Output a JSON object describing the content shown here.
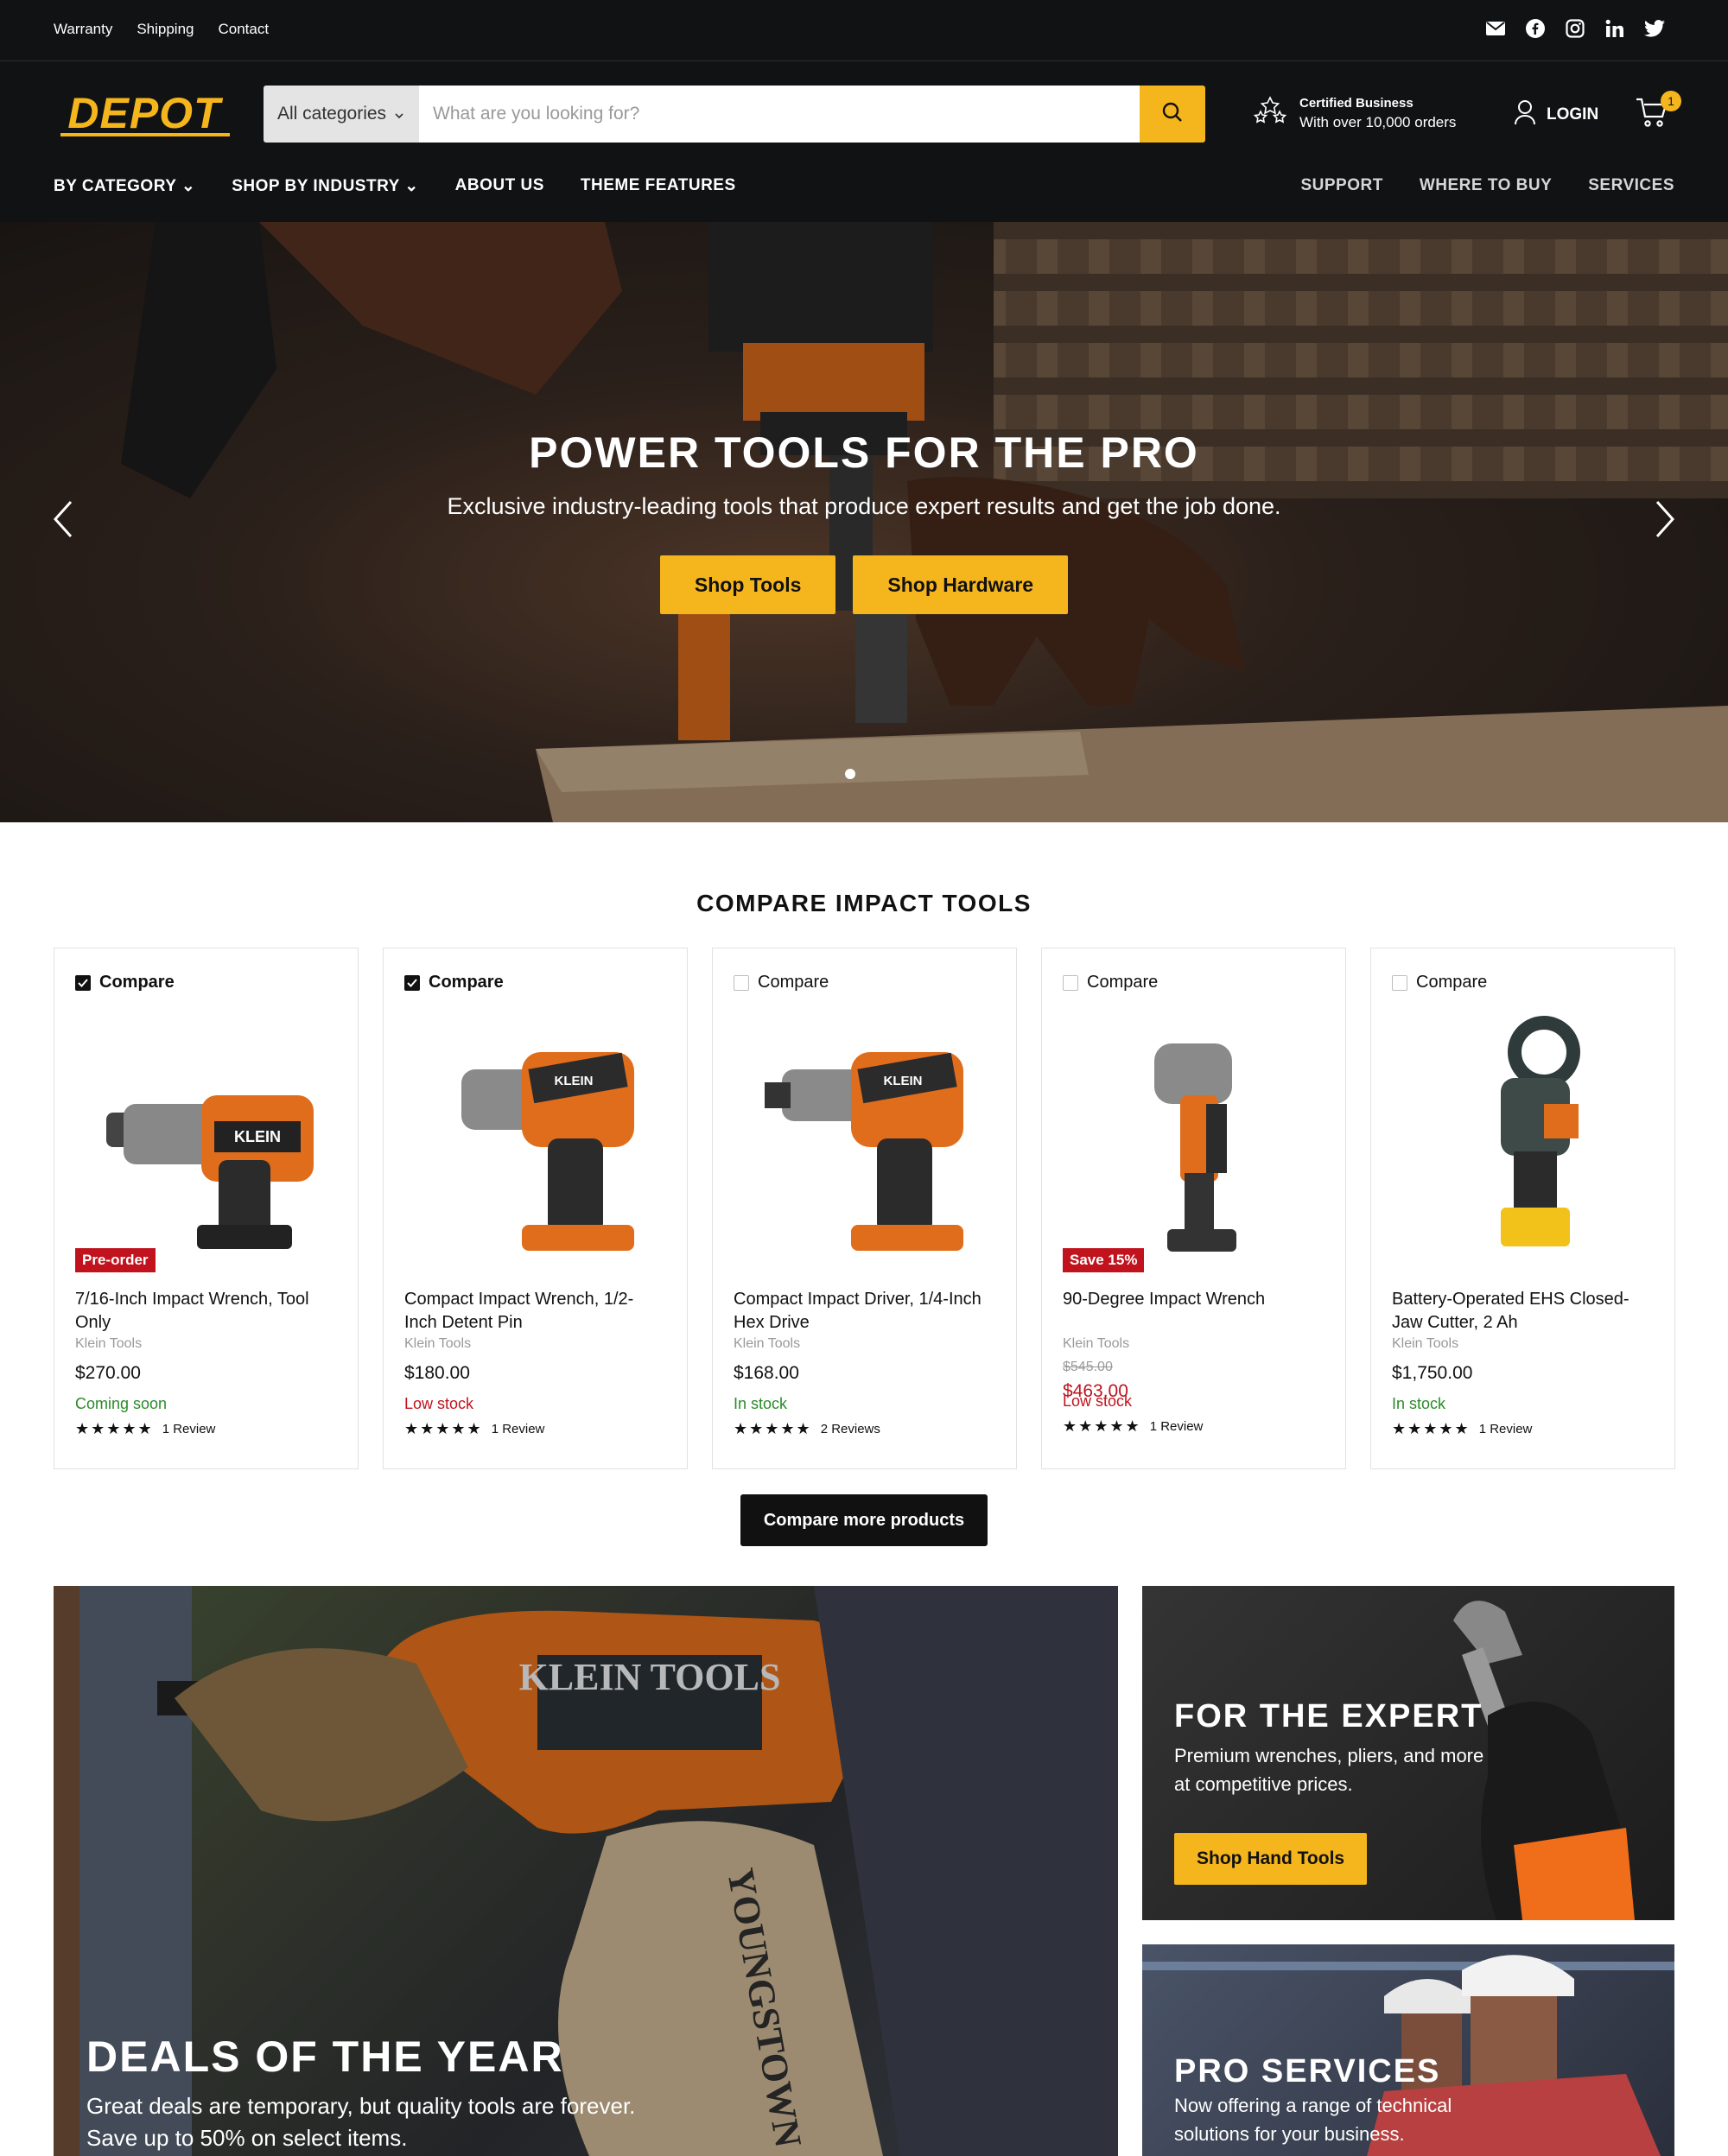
{
  "utility": {
    "links": [
      "Warranty",
      "Shipping",
      "Contact"
    ]
  },
  "header": {
    "logo_text": "DEPOT",
    "category_select": "All categories",
    "search_placeholder": "What are you looking for?",
    "cert_title": "Certified Business",
    "cert_sub": "With over 10,000 orders",
    "login_label": "LOGIN",
    "cart_count": "1"
  },
  "nav": {
    "left": [
      "BY CATEGORY",
      "SHOP BY INDUSTRY",
      "ABOUT US",
      "THEME FEATURES"
    ],
    "right": [
      "SUPPORT",
      "WHERE TO BUY",
      "SERVICES"
    ]
  },
  "hero": {
    "title": "POWER TOOLS FOR THE PRO",
    "subtitle": "Exclusive industry-leading tools that produce expert results and get the job done.",
    "button1": "Shop Tools",
    "button2": "Shop Hardware"
  },
  "compare": {
    "title": "COMPARE IMPACT TOOLS",
    "compare_label": "Compare",
    "more_button": "Compare more products",
    "products": [
      {
        "name": "7/16-Inch Impact Wrench, Tool Only",
        "brand": "Klein Tools",
        "price": "$270.00",
        "tag": "Pre-order",
        "stock": "Coming soon",
        "reviews": "1 Review",
        "checked": true
      },
      {
        "name": "Compact Impact Wrench, 1/2-Inch Detent Pin",
        "brand": "Klein Tools",
        "price": "$180.00",
        "tag": "",
        "stock": "Low stock",
        "reviews": "1 Review",
        "checked": true
      },
      {
        "name": "Compact Impact Driver, 1/4-Inch Hex Drive",
        "brand": "Klein Tools",
        "price": "$168.00",
        "tag": "",
        "stock": "In stock",
        "reviews": "2 Reviews",
        "checked": false
      },
      {
        "name": "90-Degree Impact Wrench",
        "brand": "Klein Tools",
        "price": "$463.00",
        "old_price": "$545.00",
        "tag": "Save 15%",
        "stock": "Low stock",
        "reviews": "1 Review",
        "checked": false
      },
      {
        "name": "Battery-Operated EHS Closed-Jaw Cutter, 2 Ah",
        "brand": "Klein Tools",
        "price": "$1,750.00",
        "tag": "",
        "stock": "In stock",
        "reviews": "1 Review",
        "checked": false
      }
    ]
  },
  "promos": {
    "deal_title": "DEALS OF THE YEAR",
    "deal_text": "Great deals are temporary, but quality tools are forever. Save up to 50% on select items.",
    "expert_title": "FOR THE EXPERT",
    "expert_text": "Premium wrenches, pliers, and more at competitive prices.",
    "expert_button": "Shop Hand Tools",
    "services_title": "PRO SERVICES",
    "services_text": "Now offering a range of technical solutions for your business.",
    "image_text_brand": "KLEIN TOOLS",
    "image_text_glove": "YOUNGSTOWN"
  },
  "colors": {
    "accent": "#f5b51c",
    "dark": "#111213",
    "sale": "#c0131d",
    "in_stock": "#2b8a2b"
  }
}
